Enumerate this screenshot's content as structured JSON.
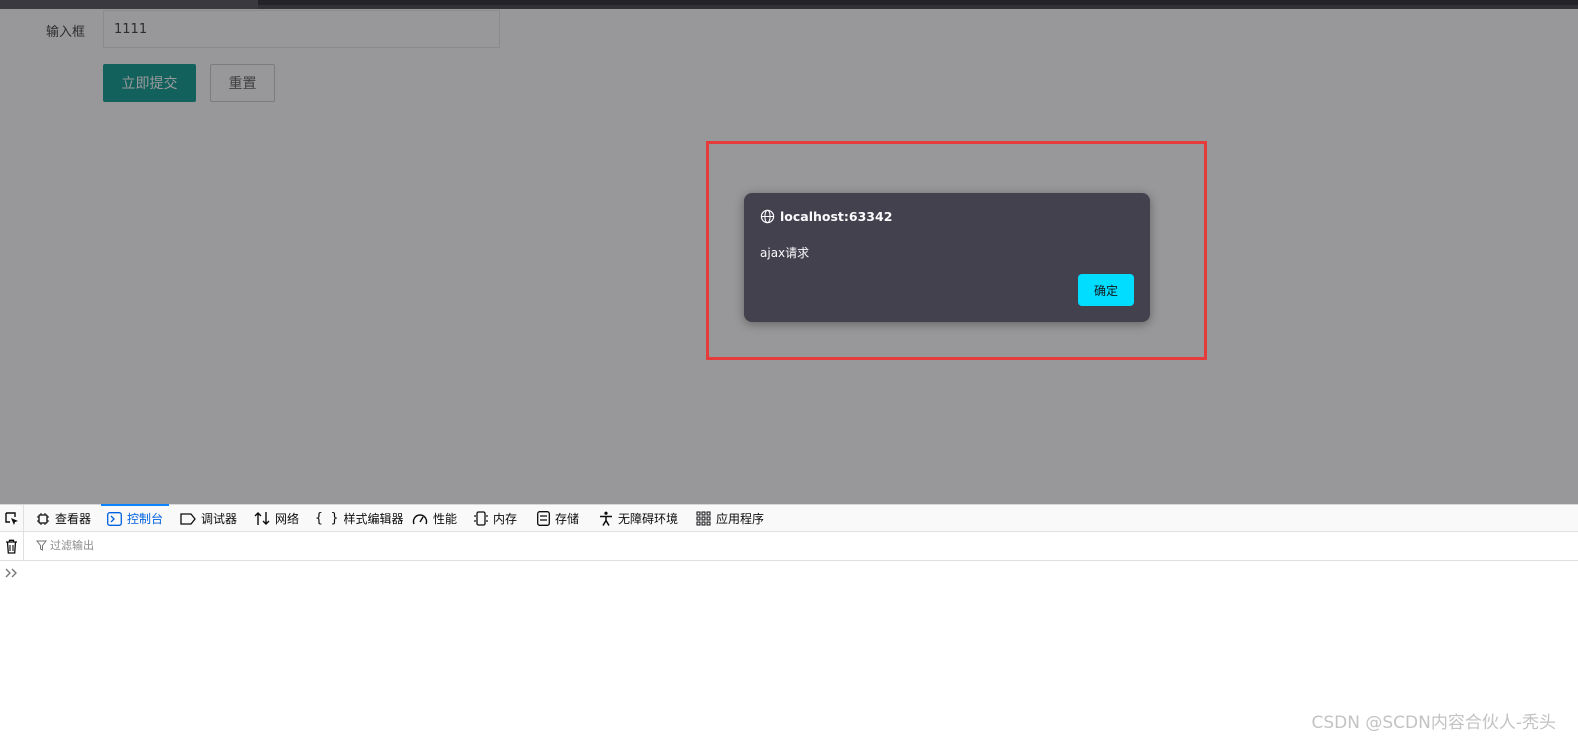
{
  "form": {
    "input_label": "输入框",
    "input_value": "1111",
    "submit_label": "立即提交",
    "reset_label": "重置"
  },
  "alert": {
    "origin": "localhost:63342",
    "message": "ajax请求",
    "ok_label": "确定"
  },
  "devtools": {
    "tabs": [
      {
        "label": "查看器",
        "icon": "inspector-icon"
      },
      {
        "label": "控制台",
        "icon": "console-icon",
        "selected": true
      },
      {
        "label": "调试器",
        "icon": "debugger-icon"
      },
      {
        "label": "网络",
        "icon": "network-icon"
      },
      {
        "label": "样式编辑器",
        "icon": "style-editor-icon"
      },
      {
        "label": "性能",
        "icon": "performance-icon"
      },
      {
        "label": "内存",
        "icon": "memory-icon"
      },
      {
        "label": "存储",
        "icon": "storage-icon"
      },
      {
        "label": "无障碍环境",
        "icon": "accessibility-icon"
      },
      {
        "label": "应用程序",
        "icon": "application-icon"
      }
    ],
    "filter_placeholder": "过滤输出"
  },
  "watermark": "CSDN @SCDN内容合伙人-秃头",
  "colors": {
    "submit_bg": "#009688",
    "alert_bg": "#42414d",
    "alert_ok_bg": "#00ddff",
    "highlight_border": "#e53b3b",
    "selected_tab": "#0060df"
  }
}
